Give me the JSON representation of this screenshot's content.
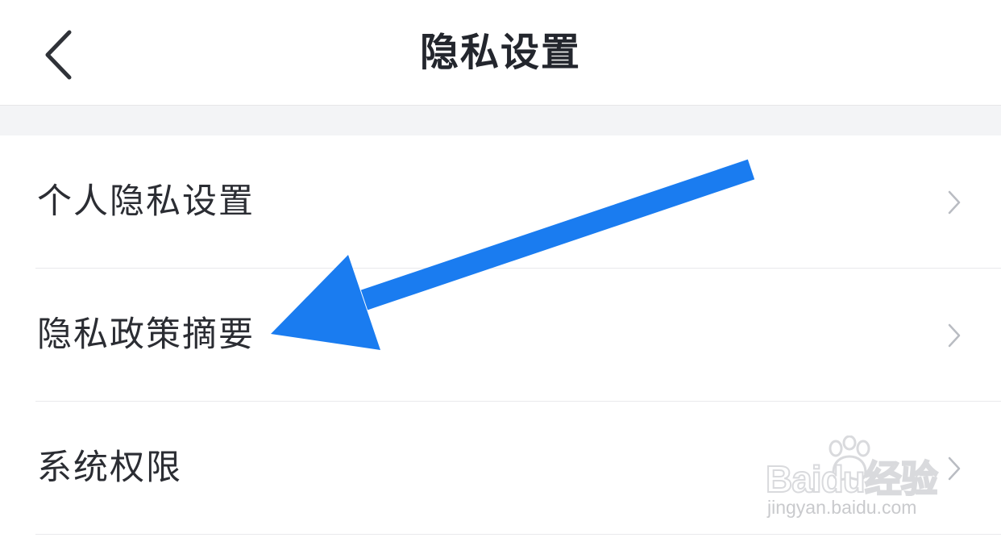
{
  "header": {
    "title": "隐私设置",
    "back_icon": "chevron-left-icon"
  },
  "menu": {
    "items": [
      {
        "label": "个人隐私设置",
        "icon": "chevron-right-icon"
      },
      {
        "label": "隐私政策摘要",
        "icon": "chevron-right-icon"
      },
      {
        "label": "系统权限",
        "icon": "chevron-right-icon"
      }
    ]
  },
  "annotation": {
    "arrow_color": "#1a7cf0",
    "points_to": "隐私政策摘要"
  },
  "watermark": {
    "brand": "Baidu经验",
    "url": "jingyan.baidu.com"
  },
  "colors": {
    "title_text": "#23262d",
    "item_text": "#2b2d33",
    "chevron": "#b9bcc2",
    "separator_band": "#f3f4f6",
    "divider": "#e9e9ec",
    "background": "#ffffff"
  }
}
